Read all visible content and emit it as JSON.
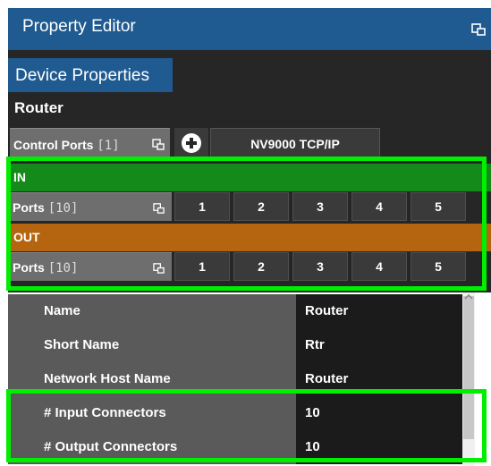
{
  "window": {
    "title": "Property Editor",
    "icons": {
      "window": "restore-window-icon"
    }
  },
  "tabs": [
    {
      "label": "Device Properties",
      "active": true
    }
  ],
  "router": {
    "label": "Router"
  },
  "control_ports": {
    "label": "Control Ports",
    "count": "[1]",
    "add_icon": "add-circle-icon",
    "items": [
      {
        "label": "NV9000 TCP/IP"
      }
    ]
  },
  "groups": {
    "in": {
      "label": "IN",
      "ports_label": "Ports",
      "ports_count": "[10]",
      "buttons": [
        "1",
        "2",
        "3",
        "4",
        "5"
      ]
    },
    "out": {
      "label": "OUT",
      "ports_label": "Ports",
      "ports_count": "[10]",
      "buttons": [
        "1",
        "2",
        "3",
        "4",
        "5"
      ]
    }
  },
  "properties": [
    {
      "name": "Name",
      "value": "Router"
    },
    {
      "name": "Short Name",
      "value": "Rtr"
    },
    {
      "name": "Network Host Name",
      "value": "Router"
    },
    {
      "name": "# Input Connectors",
      "value": "10"
    },
    {
      "name": "# Output Connectors",
      "value": "10"
    }
  ],
  "colors": {
    "title_bg": "#1f5a90",
    "in_header": "#148a1a",
    "out_header": "#b5650f",
    "highlight": "#00ee00",
    "panel_bg": "#262626"
  }
}
